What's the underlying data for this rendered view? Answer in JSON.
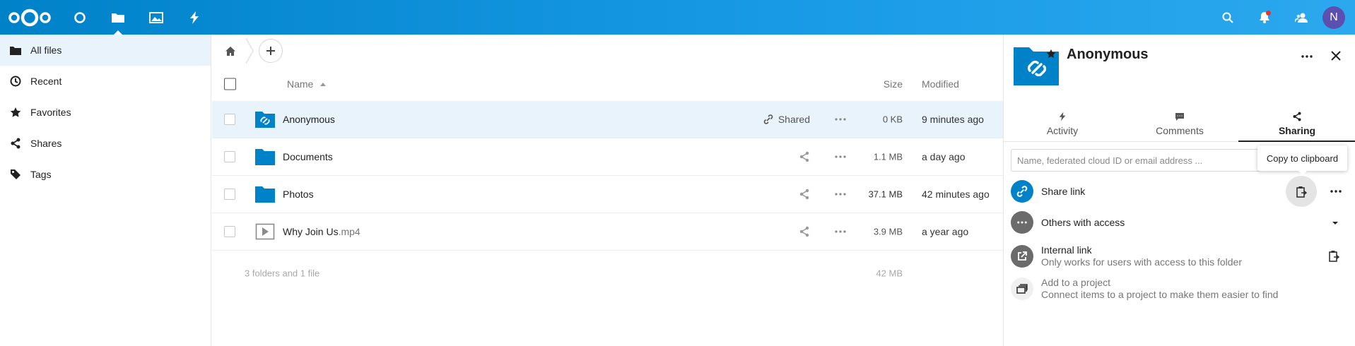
{
  "header": {
    "apps": [
      {
        "name": "dashboard",
        "icon": "circle-icon"
      },
      {
        "name": "files",
        "icon": "folder-icon",
        "active": true
      },
      {
        "name": "photos",
        "icon": "image-icon"
      },
      {
        "name": "activity",
        "icon": "lightning-icon"
      }
    ],
    "avatar_initial": "N",
    "colors": {
      "accent": "#0082c9",
      "avatar": "#5b4fb0",
      "notification": "#e9322d"
    }
  },
  "nav": {
    "items": [
      {
        "label": "All files",
        "icon": "folder-icon",
        "active": true
      },
      {
        "label": "Recent",
        "icon": "clock-icon"
      },
      {
        "label": "Favorites",
        "icon": "star-icon"
      },
      {
        "label": "Shares",
        "icon": "share-icon"
      },
      {
        "label": "Tags",
        "icon": "tag-icon"
      }
    ]
  },
  "files": {
    "columns": {
      "name": "Name",
      "size": "Size",
      "modified": "Modified"
    },
    "rows": [
      {
        "name": "Anonymous",
        "ext": "",
        "type": "shared-link-folder",
        "share_label": "Shared",
        "size": "0 KB",
        "modified": "9 minutes ago",
        "selected": true
      },
      {
        "name": "Documents",
        "ext": "",
        "type": "folder",
        "share_label": "",
        "size": "1.1 MB",
        "modified": "a day ago"
      },
      {
        "name": "Photos",
        "ext": "",
        "type": "folder",
        "share_label": "",
        "size": "37.1 MB",
        "modified": "42 minutes ago"
      },
      {
        "name": "Why Join Us",
        "ext": ".mp4",
        "type": "video",
        "share_label": "",
        "size": "3.9 MB",
        "modified": "a year ago"
      }
    ],
    "summary": {
      "count_text": "3 folders and 1 file",
      "total_size": "42 MB"
    }
  },
  "sidebar": {
    "title": "Anonymous",
    "tabs": [
      {
        "label": "Activity",
        "icon": "lightning-icon"
      },
      {
        "label": "Comments",
        "icon": "comment-icon"
      },
      {
        "label": "Sharing",
        "icon": "share-icon",
        "active": true
      }
    ],
    "share_input_placeholder": "Name, federated cloud ID or email address ...",
    "tooltip": "Copy to clipboard",
    "share_link_label": "Share link",
    "others_label": "Others with access",
    "internal_link": {
      "title": "Internal link",
      "subtitle": "Only works for users with access to this folder"
    },
    "project": {
      "title": "Add to a project",
      "subtitle": "Connect items to a project to make them easier to find"
    },
    "colors": {
      "link_avatar": "#0082c9",
      "grey_avatar": "#6b6b6b"
    }
  }
}
